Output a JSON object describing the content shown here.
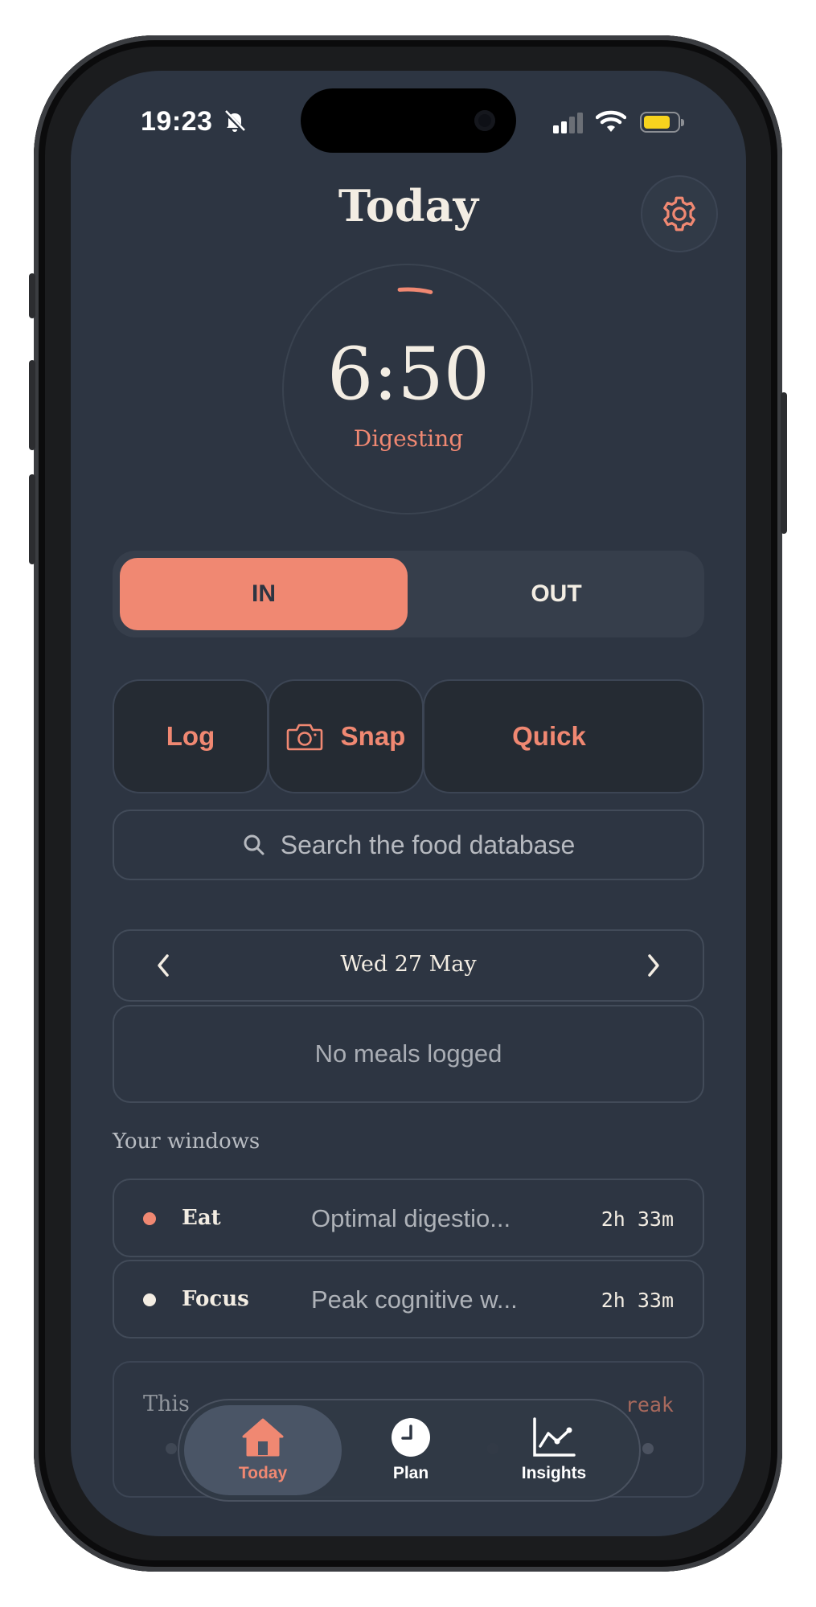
{
  "status_bar": {
    "time": "19:23",
    "icons": [
      "bell-slash-icon",
      "cellular-icon",
      "wifi-icon",
      "battery-icon"
    ]
  },
  "header": {
    "title": "Today",
    "settings_icon": "gear-icon"
  },
  "timer": {
    "value": "6:50",
    "status": "Digesting",
    "progress": 0.05
  },
  "toggle": {
    "in_label": "IN",
    "out_label": "OUT",
    "selected": "IN"
  },
  "actions": {
    "log": "Log",
    "snap": "Snap",
    "quick": "Quick"
  },
  "search": {
    "placeholder": "Search the food database"
  },
  "date_nav": {
    "date": "Wed 27 May"
  },
  "meals": {
    "empty": "No meals logged"
  },
  "windows": {
    "heading": "Your windows",
    "items": [
      {
        "name": "Eat",
        "desc": "Optimal digestio...",
        "duration": "2h 33m",
        "dot_color": "#f08872"
      },
      {
        "name": "Focus",
        "desc": "Peak cognitive w...",
        "duration": "2h 33m",
        "dot_color": "#f3ede3"
      }
    ]
  },
  "streak_card": {
    "label": "This",
    "right": "reak"
  },
  "tabs": [
    {
      "label": "Today",
      "icon": "home-icon"
    },
    {
      "label": "Plan",
      "icon": "clock-icon"
    },
    {
      "label": "Insights",
      "icon": "chart-icon"
    }
  ],
  "colors": {
    "accent": "#f08872",
    "background": "#2d3542",
    "text": "#f3ede3"
  }
}
